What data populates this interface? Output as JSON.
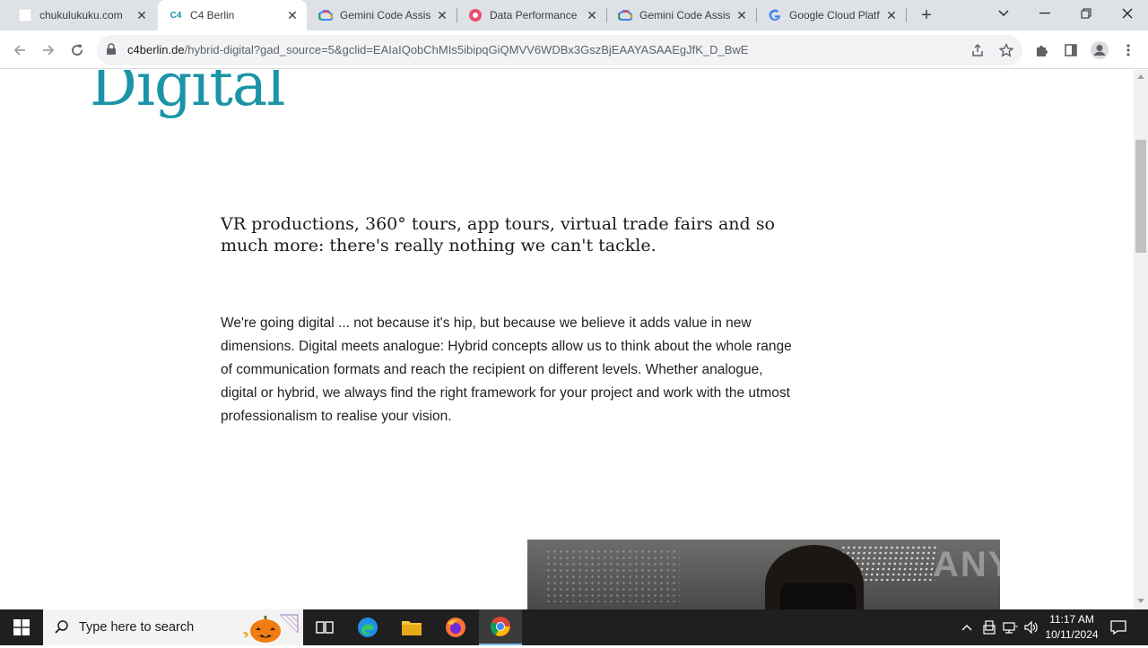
{
  "browser": {
    "tabs": [
      {
        "title": "chukulukuku.com",
        "favicon": "blank-page-icon"
      },
      {
        "title": "C4 Berlin",
        "favicon": "c4-logo-icon",
        "favicon_text": "C4"
      },
      {
        "title": "Gemini Code Assis",
        "favicon": "google-cloud-icon"
      },
      {
        "title": "Data Performance",
        "favicon": "data-performance-icon"
      },
      {
        "title": "Gemini Code Assis",
        "favicon": "google-cloud-icon"
      },
      {
        "title": "Google Cloud Platf",
        "favicon": "google-g-icon"
      }
    ],
    "active_tab_index": 1,
    "url_domain": "c4berlin.de",
    "url_path": "/hybrid-digital?gad_source=5&gclid=EAIaIQobChMIs5ibipqGiQMVV6WDBx3GszBjEAAYASAAEgJfK_D_BwE"
  },
  "page": {
    "hero_word": "Digital",
    "lead": "VR productions, 360° tours, app tours, virtual trade fairs and so much more: there's really nothing we can't tackle.",
    "body": "We're going digital ... not because it's hip, but because we believe it adds value in new dimensions. Digital meets analogue: Hybrid concepts allow us to think about the whole range of communication formats and reach the recipient on different levels. Whether analogue, digital or hybrid, we always find the right framework for your project and work with the utmost professionalism to realise your vision.",
    "watermark": "ANY RUN"
  },
  "taskbar": {
    "search_placeholder": "Type here to search",
    "time": "11:17 AM",
    "date": "10/11/2024"
  },
  "colors": {
    "accent": "#1a94a8",
    "tabstrip": "#dee1e6",
    "taskbar": "#1f1f1f"
  }
}
